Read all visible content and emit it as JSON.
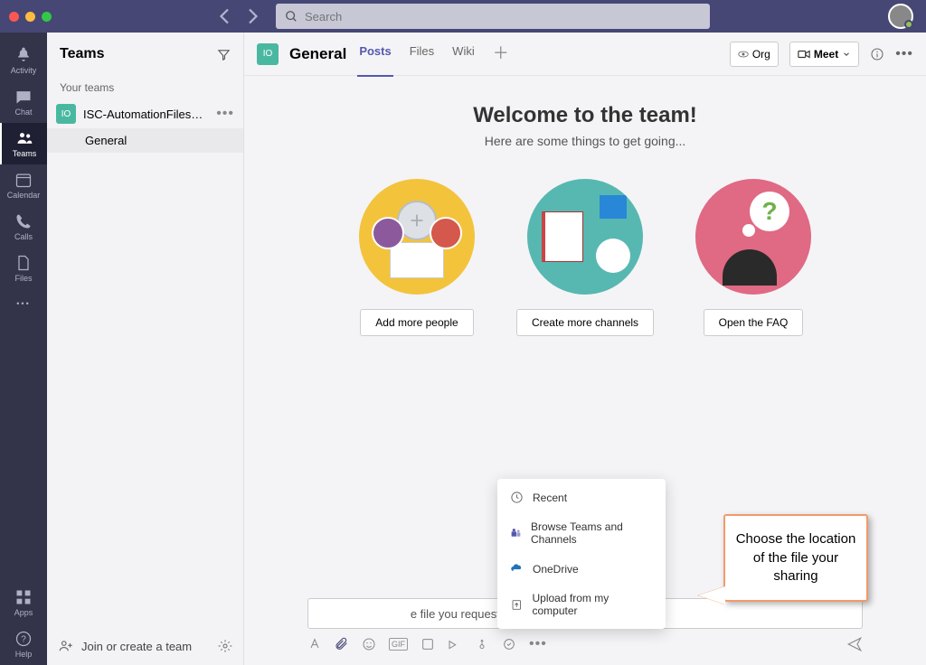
{
  "search": {
    "placeholder": "Search"
  },
  "rail": [
    {
      "label": "Activity"
    },
    {
      "label": "Chat"
    },
    {
      "label": "Teams"
    },
    {
      "label": "Calendar"
    },
    {
      "label": "Calls"
    },
    {
      "label": "Files"
    }
  ],
  "rail_bottom": [
    {
      "label": "Apps"
    },
    {
      "label": "Help"
    }
  ],
  "sidebar": {
    "title": "Teams",
    "section": "Your teams",
    "team": {
      "initials": "IO",
      "name": "ISC-AutomationFilesAnd..."
    },
    "channel": "General",
    "footer": "Join or create a team"
  },
  "header": {
    "initials": "IO",
    "title": "General",
    "tabs": [
      "Posts",
      "Files",
      "Wiki"
    ],
    "org": "Org",
    "meet": "Meet"
  },
  "welcome": {
    "title": "Welcome to the team!",
    "sub": "Here are some things to get going..."
  },
  "cards": [
    "Add more people",
    "Create more channels",
    "Open the FAQ"
  ],
  "attach_menu": [
    "Recent",
    "Browse Teams and Channels",
    "OneDrive",
    "Upload from my computer"
  ],
  "callout": "Choose the location of the file your sharing",
  "message_fragment": "e file you requested."
}
